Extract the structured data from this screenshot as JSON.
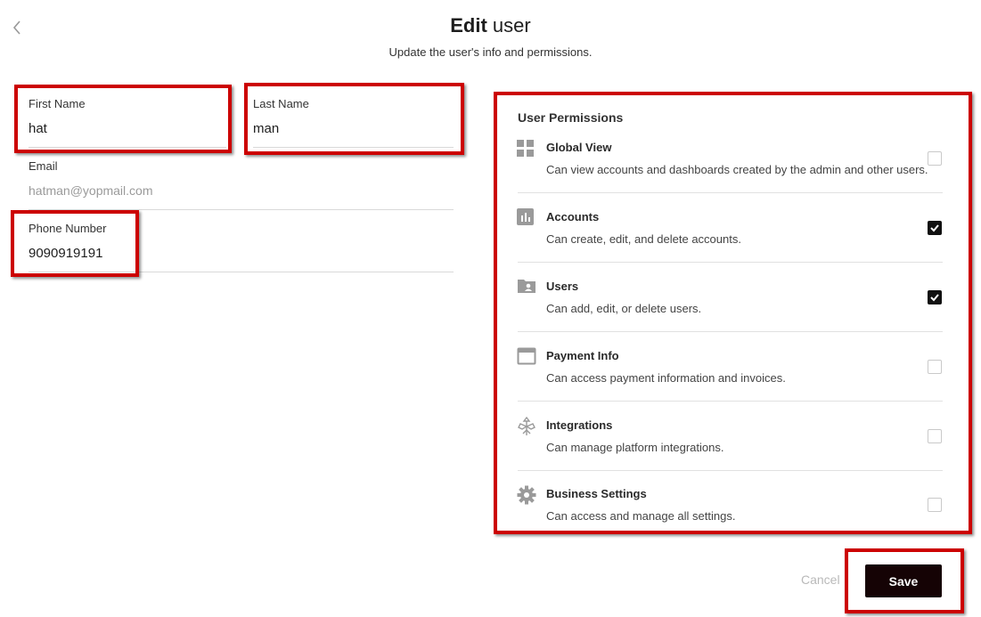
{
  "header": {
    "title_bold": "Edit",
    "title_rest": " user",
    "subtitle": "Update the user's info and permissions."
  },
  "form": {
    "first_name": {
      "label": "First Name",
      "value": "hat"
    },
    "last_name": {
      "label": "Last Name",
      "value": "man"
    },
    "email": {
      "label": "Email",
      "value": "hatman@yopmail.com"
    },
    "phone": {
      "label": "Phone Number",
      "value": "9090919191"
    }
  },
  "permissions": {
    "title": "User Permissions",
    "items": [
      {
        "name": "Global View",
        "description": "Can view accounts and dashboards created by the admin and other users.",
        "icon": "grid-icon",
        "checked": false
      },
      {
        "name": "Accounts",
        "description": "Can create, edit, and delete accounts.",
        "icon": "bar-chart-icon",
        "checked": true
      },
      {
        "name": "Users",
        "description": "Can add, edit, or delete users.",
        "icon": "user-folder-icon",
        "checked": true
      },
      {
        "name": "Payment Info",
        "description": "Can access payment information and invoices.",
        "icon": "card-icon",
        "checked": false
      },
      {
        "name": "Integrations",
        "description": "Can manage platform integrations.",
        "icon": "integrations-icon",
        "checked": false
      },
      {
        "name": "Business Settings",
        "description": "Can access and manage all settings.",
        "icon": "gear-icon",
        "checked": false
      }
    ]
  },
  "actions": {
    "cancel_label": "Cancel",
    "save_label": "Save"
  },
  "colors": {
    "highlight": "#cc0000",
    "save_bg": "#150305",
    "icon_gray": "#9a9a9a"
  }
}
